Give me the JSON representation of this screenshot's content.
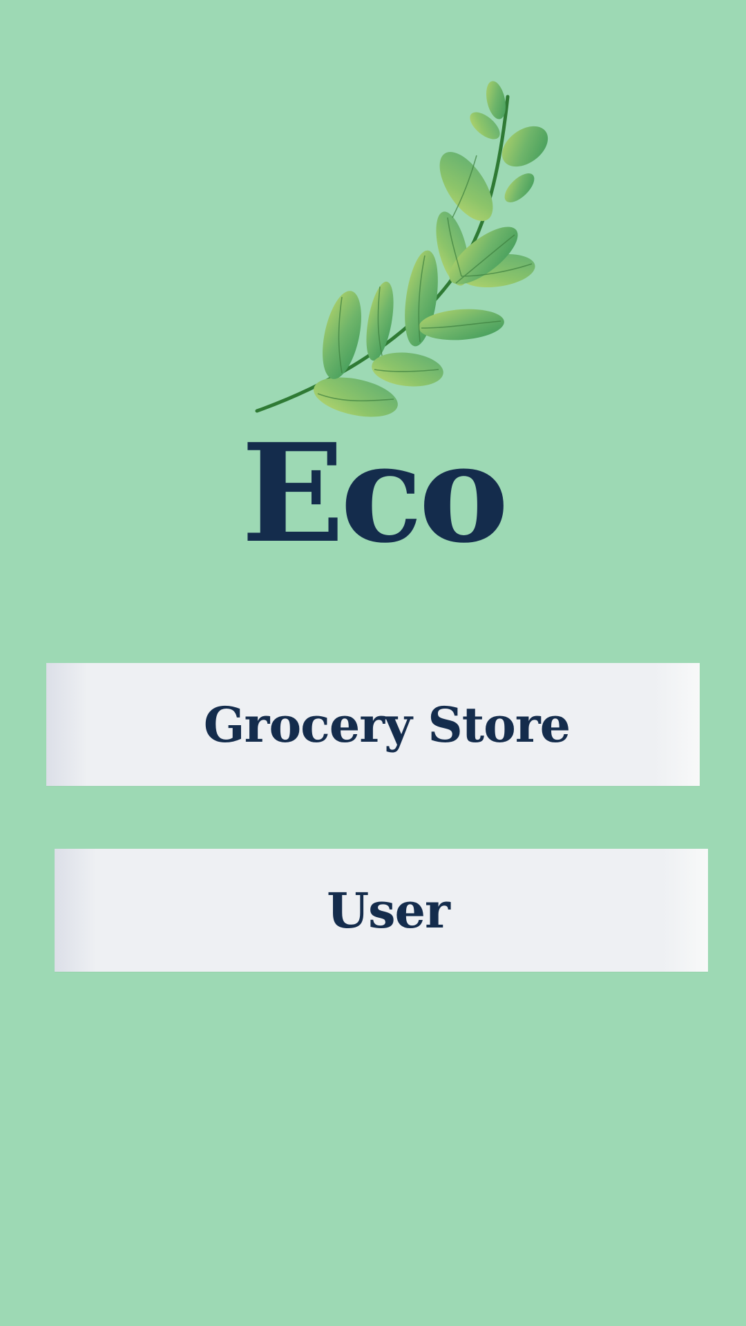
{
  "app": {
    "title": "Eco",
    "logo_icon": "leaf-branch-icon",
    "background_color": "#9dd9b4",
    "text_color": "#142c4c"
  },
  "actions": {
    "grocery_store_label": "Grocery Store",
    "user_label": "User"
  }
}
